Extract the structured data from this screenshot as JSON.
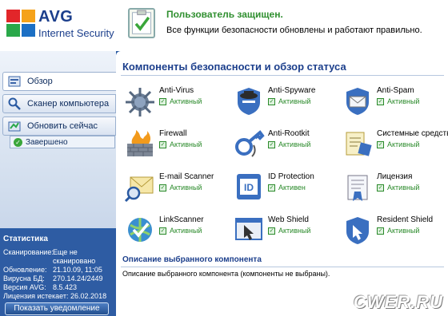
{
  "header": {
    "logo_brand": "AVG",
    "logo_product": "Internet Security",
    "status_title": "Пользователь защищен.",
    "status_desc": "Все функции безопасности обновлены и работают правильно."
  },
  "sidebar": {
    "nav": [
      {
        "label": "Обзор",
        "icon": "home-icon"
      },
      {
        "label": "Сканер компьютера",
        "icon": "magnifier-icon"
      },
      {
        "label": "Обновить сейчас",
        "icon": "update-icon"
      }
    ],
    "update_status": "Завершено",
    "stats": {
      "title": "Статистика",
      "rows": [
        {
          "key": "Сканирование:",
          "value": "Еще не"
        },
        {
          "key": "",
          "value": "сканировано"
        },
        {
          "key": "Обновление:",
          "value": "21.10.09, 11:05"
        },
        {
          "key": "Вирусна БД:",
          "value": "270.14.24/2449"
        },
        {
          "key": "Версия AVG:",
          "value": "8.5.423"
        },
        {
          "key": "Лицензия истекает:",
          "value": "26.02.2018"
        }
      ],
      "notify_button": "Показать уведомление"
    }
  },
  "main": {
    "title": "Компоненты безопасности и обзор статуса",
    "components": [
      {
        "name": "Anti-Virus",
        "status": "Активный",
        "icon": "antivirus-icon"
      },
      {
        "name": "Anti-Spyware",
        "status": "Активный",
        "icon": "antispyware-icon"
      },
      {
        "name": "Anti-Spam",
        "status": "Активный",
        "icon": "antispam-icon"
      },
      {
        "name": "Firewall",
        "status": "Активный",
        "icon": "firewall-icon"
      },
      {
        "name": "Anti-Rootkit",
        "status": "Активный",
        "icon": "antirootkit-icon"
      },
      {
        "name": "Системные средства",
        "status": "Активный",
        "icon": "system-tools-icon"
      },
      {
        "name": "E-mail Scanner",
        "status": "Активный",
        "icon": "email-scanner-icon"
      },
      {
        "name": "ID Protection",
        "status": "Активен",
        "icon": "id-protection-icon"
      },
      {
        "name": "Лицензия",
        "status": "Активный",
        "icon": "license-icon"
      },
      {
        "name": "LinkScanner",
        "status": "Активный",
        "icon": "linkscanner-icon"
      },
      {
        "name": "Web Shield",
        "status": "Активный",
        "icon": "web-shield-icon"
      },
      {
        "name": "Resident Shield",
        "status": "Активный",
        "icon": "resident-shield-icon"
      }
    ],
    "description_title": "Описание выбранного компонента",
    "description_text": "Описание выбранного компонента (компоненты не выбраны)."
  },
  "watermark": "CWER.RU",
  "colors": {
    "brand_blue": "#1c3f8c",
    "status_green": "#2f8f2f",
    "sidebar_blue": "#2e5ca3"
  }
}
